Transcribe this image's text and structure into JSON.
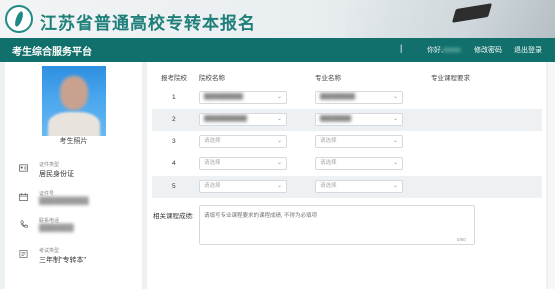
{
  "header": {
    "site_title": "江苏省普通高校专转本报名"
  },
  "navbar": {
    "title": "考生综合服务平台",
    "separator": "|",
    "greeting": "你好,",
    "change_password": "修改密码",
    "logout": "退出登录"
  },
  "sidebar": {
    "photo_label": "考生照片",
    "fields": [
      {
        "label": "证件类型",
        "value": "居民身份证",
        "icon": "id-card-icon"
      },
      {
        "label": "证件号",
        "value": "",
        "icon": "calendar-icon"
      },
      {
        "label": "联系电话",
        "value": "",
        "icon": "phone-icon"
      },
      {
        "label": "考试类型",
        "value": "三年制\"专转本\"",
        "icon": "exam-type-icon"
      }
    ]
  },
  "table": {
    "headers": {
      "order": "报考院校",
      "school": "院校名称",
      "major": "专业名称",
      "requirement": "专业课程要求"
    },
    "rows": [
      {
        "num": "1",
        "school": "",
        "major": ""
      },
      {
        "num": "2",
        "school": "",
        "major": ""
      },
      {
        "num": "3",
        "school": "请选择",
        "major": "请选择"
      },
      {
        "num": "4",
        "school": "请选择",
        "major": "请选择"
      },
      {
        "num": "5",
        "school": "请选择",
        "major": "请选择"
      }
    ]
  },
  "remark": {
    "label": "相关课程成绩:",
    "placeholder": "请填写专业课程要求的课程成绩, 不得为必填项",
    "counter": "0/50"
  },
  "colors": {
    "primary": "#12706c",
    "title": "#1f7f7a",
    "row_shade": "#eef1f4"
  }
}
